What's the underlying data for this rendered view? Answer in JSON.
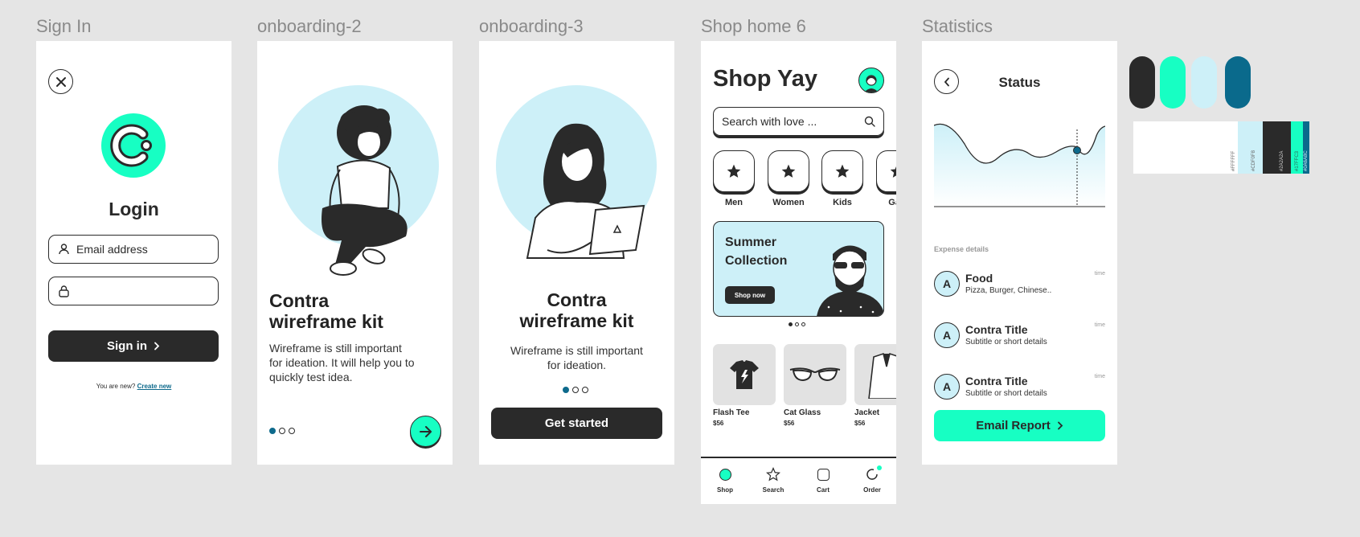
{
  "frames": {
    "signin": {
      "label": "Sign In"
    },
    "onb2": {
      "label": "onboarding-2"
    },
    "onb3": {
      "label": "onboarding-3"
    },
    "shop": {
      "label": "Shop home 6"
    },
    "stats": {
      "label": "Statistics"
    }
  },
  "signin": {
    "title": "Login",
    "email_placeholder": "Email address",
    "password_value": "",
    "signin_label": "Sign in",
    "new_text": "You are new?",
    "create_link": "Create new"
  },
  "onb2": {
    "headline_1": "Contra",
    "headline_2": "wireframe kit",
    "body_1": "Wireframe is still important",
    "body_2": "for ideation. It will help you to",
    "body_3": "quickly test idea."
  },
  "onb3": {
    "headline_1": "Contra",
    "headline_2": "wireframe kit",
    "body_1": "Wireframe is still important",
    "body_2": "for ideation.",
    "cta": "Get started"
  },
  "shop": {
    "title": "Shop Yay",
    "search_placeholder": "Search with love ...",
    "categories": [
      {
        "label": "Men"
      },
      {
        "label": "Women"
      },
      {
        "label": "Kids"
      },
      {
        "label": "Gad"
      }
    ],
    "banner": {
      "title_1": "Summer",
      "title_2": "Collection",
      "button": "Shop now"
    },
    "products": [
      {
        "name": "Flash Tee",
        "price": "$56"
      },
      {
        "name": "Cat Glass",
        "price": "$56"
      },
      {
        "name": "Jacket",
        "price": "$56"
      }
    ],
    "nav": [
      {
        "label": "Shop"
      },
      {
        "label": "Search"
      },
      {
        "label": "Cart"
      },
      {
        "label": "Order"
      }
    ]
  },
  "stats": {
    "title": "Status",
    "section": "Expense details",
    "rows": [
      {
        "avatar": "A",
        "title": "Food",
        "subtitle": "Pizza, Burger, Chinese..",
        "time": "time"
      },
      {
        "avatar": "A",
        "title": "Contra Title",
        "subtitle": "Subtitle or short details",
        "time": "time"
      },
      {
        "avatar": "A",
        "title": "Contra Title",
        "subtitle": "Subtitle or short details",
        "time": "time"
      }
    ],
    "button": "Email Report"
  },
  "palette": {
    "colors": [
      "#2A2A2A",
      "#17FFC3",
      "#CDF0F8",
      "#0A6A8C"
    ],
    "strip": [
      {
        "hex": "#FFFFFF",
        "label": "#FFFFFF"
      },
      {
        "hex": "#CDF0F8",
        "label": "#CDF0F8"
      },
      {
        "hex": "#2A2A2A",
        "label": "#2A2A2A"
      },
      {
        "hex": "#17FFC3",
        "label": "#17FFC3"
      },
      {
        "hex": "#0A6A8C",
        "label": "#0A6A8C"
      }
    ]
  },
  "colors": {
    "accent": "#17FFC3",
    "dark": "#2A2A2A",
    "light_blue": "#CDF0F8",
    "teal": "#0A6A8C",
    "background": "#E5E5E5"
  }
}
